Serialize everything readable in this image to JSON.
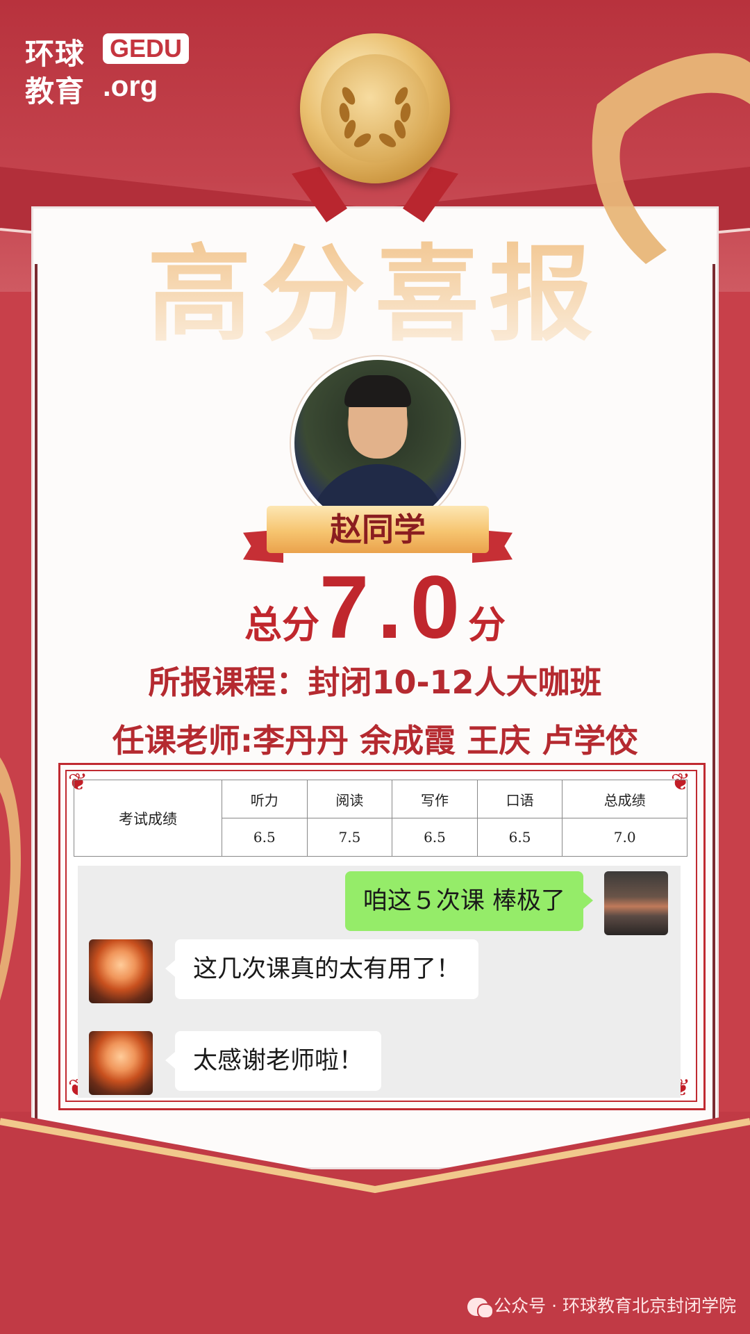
{
  "logo": {
    "cn_line1": "环球",
    "cn_line2": "教育",
    "gedu": "GEDU",
    "org": ".org"
  },
  "headline": "高分喜报",
  "student": {
    "name": "赵同学"
  },
  "score": {
    "prefix": "总分",
    "value": "7.0",
    "suffix": "分"
  },
  "course": "所报课程：封闭10-12人大咖班",
  "teachers": "任课老师:李丹丹  余成霞  王庆  卢学佼",
  "table": {
    "row_label": "考试成绩",
    "headers": [
      "听力",
      "阅读",
      "写作",
      "口语",
      "总成绩"
    ],
    "values": [
      "6.5",
      "7.5",
      "6.5",
      "6.5",
      "7.0"
    ]
  },
  "chat": [
    {
      "side": "right",
      "text": "咱这５次课 棒极了"
    },
    {
      "side": "left",
      "text": "这几次课真的太有用了！"
    },
    {
      "side": "left",
      "text": "太感谢老师啦！"
    }
  ],
  "footer": "公众号 · 环球教育北京封闭学院",
  "colors": {
    "primary_red": "#c13a45",
    "gold": "#e9bf6f",
    "score_red": "#c0272d",
    "chat_green": "#95ec69"
  }
}
